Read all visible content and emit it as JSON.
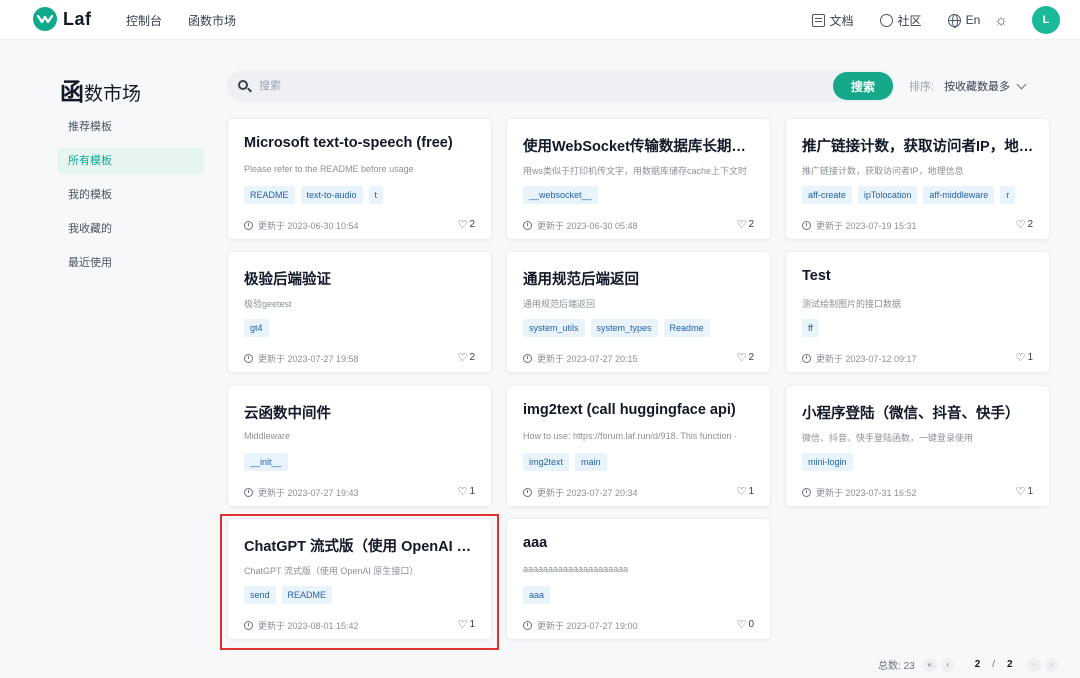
{
  "header": {
    "logo_text": "Laf",
    "nav": [
      "控制台",
      "函数市场"
    ],
    "docs": "文档",
    "community": "社区",
    "lang": "En",
    "avatar": "L"
  },
  "sidebar": {
    "title_first": "函",
    "title_rest": "数市场",
    "items": [
      "推荐模板",
      "所有模板",
      "我的模板",
      "我收藏的",
      "最近使用"
    ],
    "active_index": 1
  },
  "search": {
    "placeholder": "搜索",
    "button": "搜索",
    "sort_label": "排序:",
    "sort_value": "按收藏数最多"
  },
  "cards": [
    {
      "title": "Microsoft text-to-speech (free)",
      "desc": "Please refer to the README before usage",
      "tags": [
        "README",
        "text-to-audio",
        "t"
      ],
      "updated": "更新于 2023-06-30 10:54",
      "likes": "2"
    },
    {
      "title": "使用WebSocket传输数据库长期储…",
      "desc": "用ws类似于打印机传文字，用数据库储存cache上下文时",
      "tags": [
        "__websocket__"
      ],
      "updated": "更新于 2023-06-30 05:48",
      "likes": "2"
    },
    {
      "title": "推广链接计数，获取访问者IP，地…",
      "desc": "推广链接计数，获取访问者IP，地理信息",
      "tags": [
        "aff-create",
        "ipTolocation",
        "aff-middleware",
        "r"
      ],
      "updated": "更新于 2023-07-19 15:31",
      "likes": "2"
    },
    {
      "title": "极验后端验证",
      "desc": "极验geetest",
      "tags": [
        "gt4"
      ],
      "updated": "更新于 2023-07-27 19:58",
      "likes": "2"
    },
    {
      "title": "通用规范后端返回",
      "desc": "通用规范后端返回",
      "tags": [
        "system_utils",
        "system_types",
        "Readme"
      ],
      "updated": "更新于 2023-07-27 20:15",
      "likes": "2"
    },
    {
      "title": "Test",
      "desc": "测试绘制图片的接口数据",
      "tags": [
        "ff"
      ],
      "updated": "更新于 2023-07-12 09:17",
      "likes": "1"
    },
    {
      "title": "云函数中间件",
      "desc": "Middleware",
      "tags": [
        "__init__"
      ],
      "updated": "更新于 2023-07-27 19:43",
      "likes": "1"
    },
    {
      "title": "img2text (call huggingface api)",
      "desc": "How to use: https://forum.laf.run/d/918. This function ·",
      "tags": [
        "img2text",
        "main"
      ],
      "updated": "更新于 2023-07-27 20:34",
      "likes": "1"
    },
    {
      "title": "小程序登陆（微信、抖音、快手）",
      "desc": "微信、抖音、快手登陆函数，一键登录使用",
      "tags": [
        "mini-login"
      ],
      "updated": "更新于 2023-07-31 16:52",
      "likes": "1"
    },
    {
      "title": "ChatGPT 流式版（使用 OpenAI …",
      "desc": "ChatGPT 流式版（使用 OpenAI 原生接口）",
      "tags": [
        "send",
        "README"
      ],
      "updated": "更新于 2023-08-01 15:42",
      "likes": "1"
    },
    {
      "title": "aaa",
      "desc": "aaaaaaaaaaaaaaaaaaaaa",
      "tags": [
        "aaa"
      ],
      "updated": "更新于 2023-07-27 19:00",
      "likes": "0"
    }
  ],
  "pager": {
    "total": "总数: 23",
    "current": "2",
    "sep": "/",
    "pages": "2",
    "first": "«",
    "prev": "‹",
    "next": "›",
    "last": "»"
  }
}
